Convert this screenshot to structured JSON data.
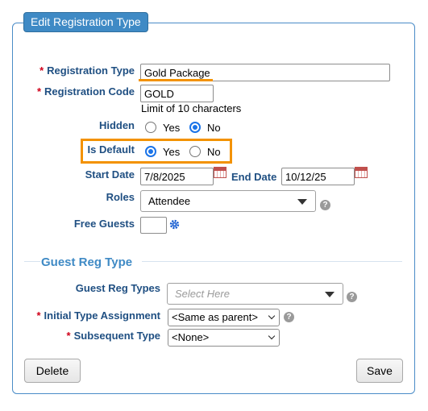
{
  "panel": {
    "legend": "Edit Registration Type"
  },
  "fields": {
    "registration_type": {
      "label": "Registration Type",
      "value": "Gold Package"
    },
    "registration_code": {
      "label": "Registration Code",
      "value": "GOLD",
      "hint": "Limit of 10 characters"
    },
    "hidden": {
      "label": "Hidden",
      "yes": "Yes",
      "no": "No",
      "selected": "No"
    },
    "is_default": {
      "label": "Is Default",
      "yes": "Yes",
      "no": "No",
      "selected": "Yes"
    },
    "start_date": {
      "label": "Start Date",
      "value": "7/8/2025"
    },
    "end_date": {
      "label": "End Date",
      "value": "10/12/25"
    },
    "roles": {
      "label": "Roles",
      "value": "Attendee"
    },
    "free_guests": {
      "label": "Free Guests",
      "value": ""
    }
  },
  "guest_section": {
    "title": "Guest Reg Type",
    "guest_reg_types": {
      "label": "Guest Reg Types",
      "placeholder": "Select Here"
    },
    "initial_type": {
      "label": "Initial Type Assignment",
      "value": "<Same as parent>"
    },
    "subsequent_type": {
      "label": "Subsequent Type",
      "value": "<None>"
    }
  },
  "buttons": {
    "delete": "Delete",
    "save": "Save"
  },
  "required_marker": "*",
  "help_glyph": "?",
  "colors": {
    "accent": "#3f8ac5",
    "label": "#1f4f82",
    "required": "#d0021b",
    "highlight": "#f39200",
    "radio": "#1a73e8"
  }
}
